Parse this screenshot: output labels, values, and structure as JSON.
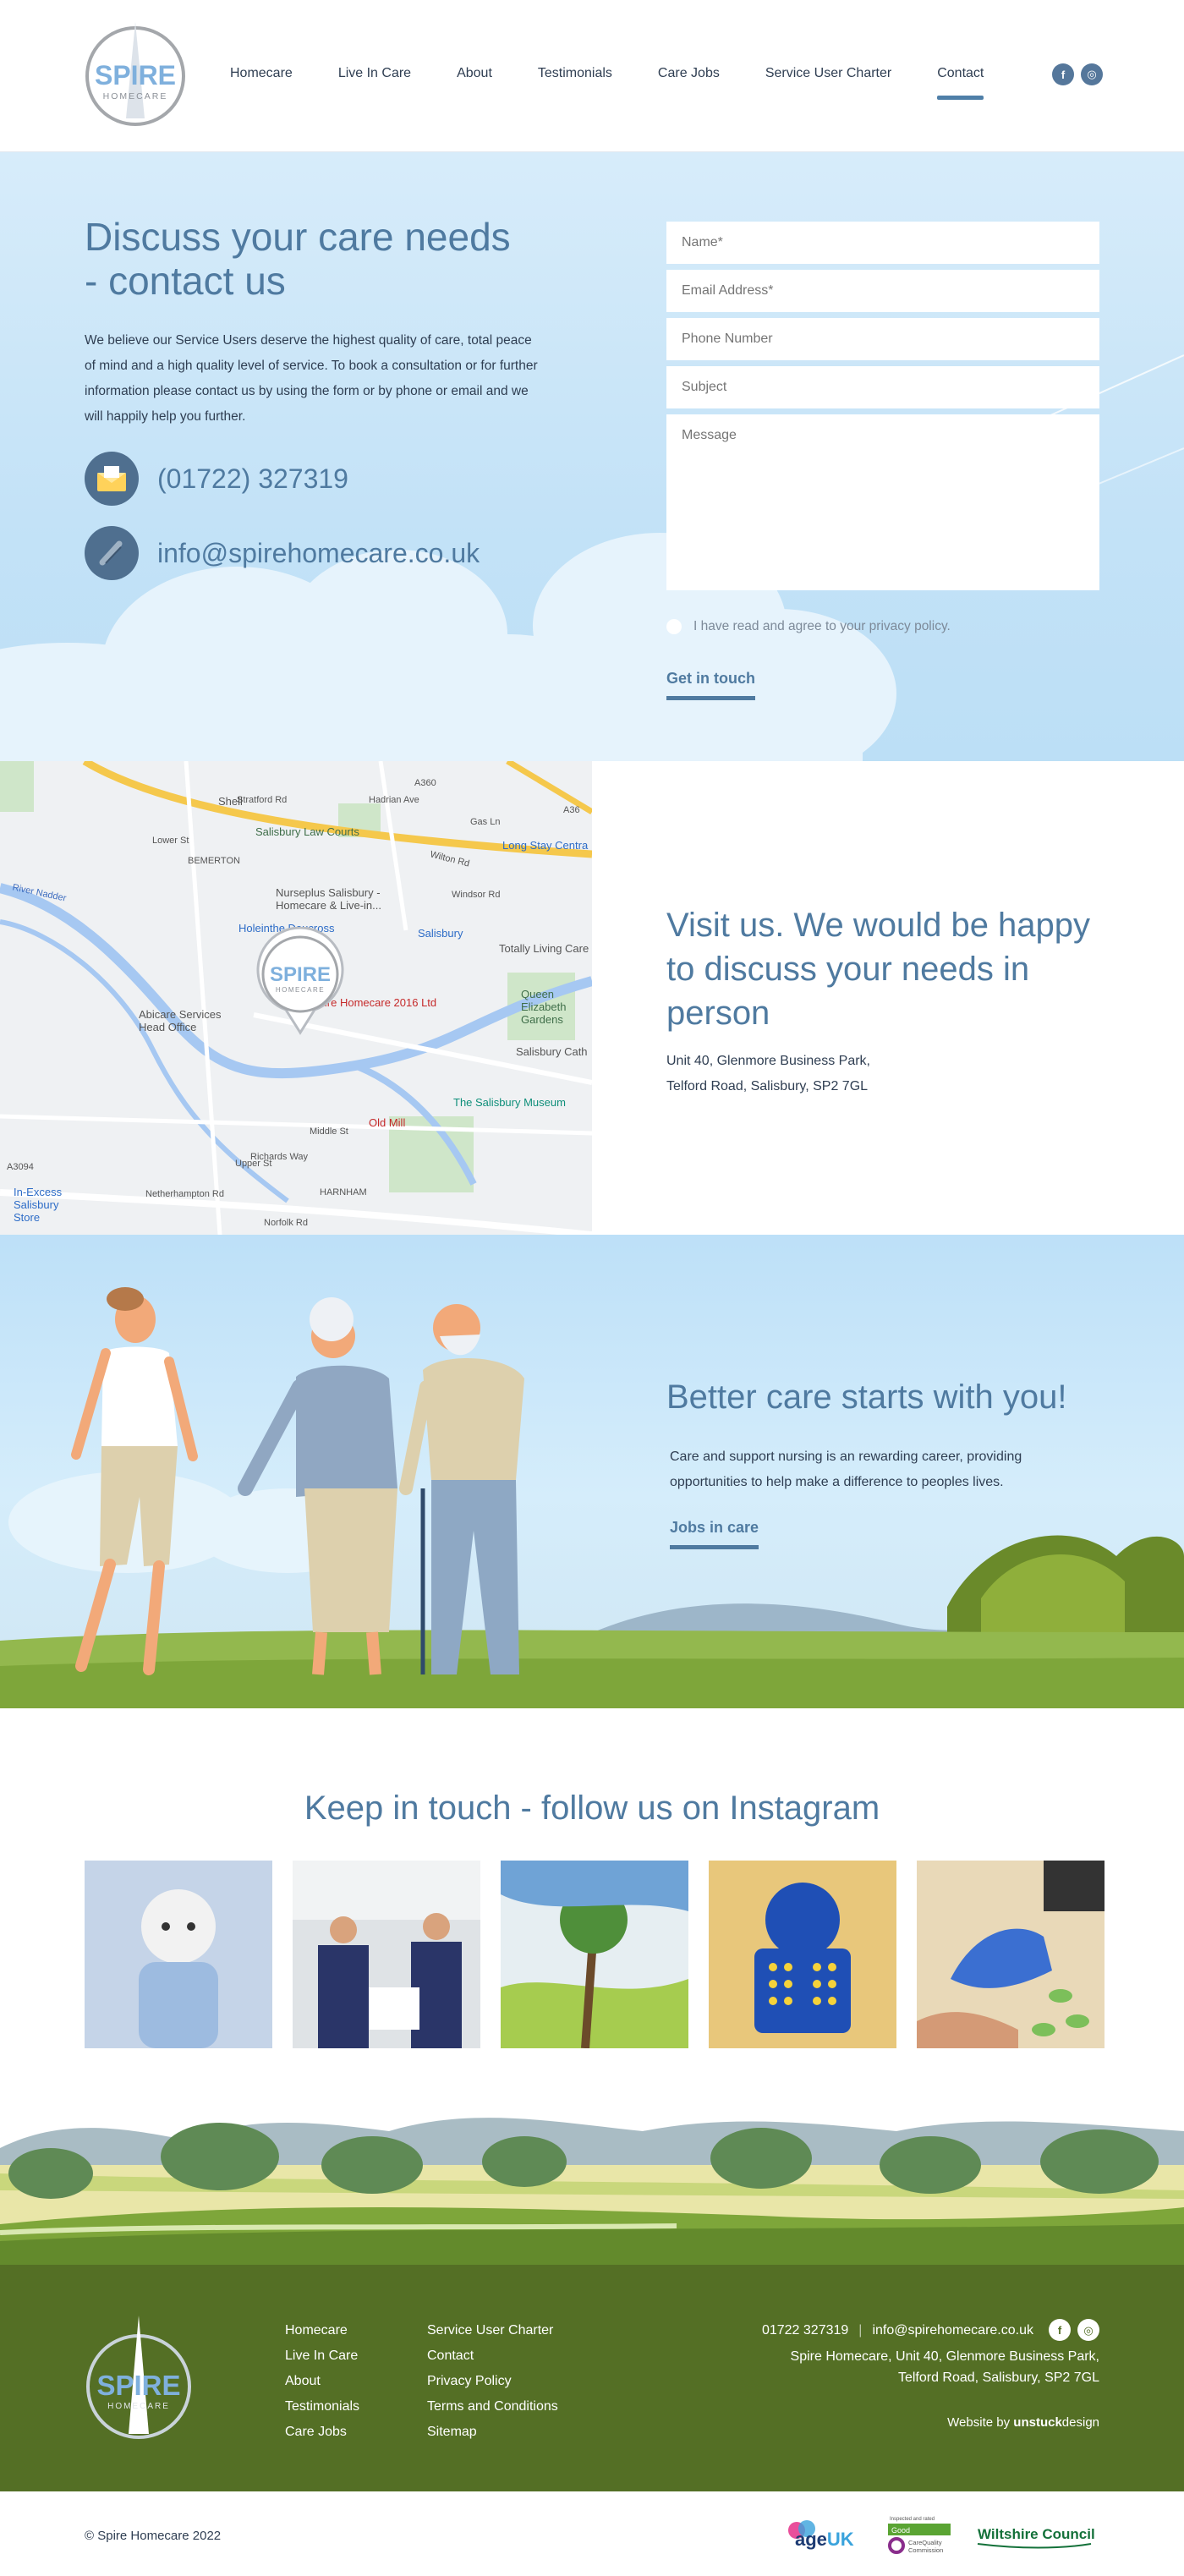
{
  "brand": {
    "name": "SPIRE",
    "sub": "HOMECARE"
  },
  "nav": [
    "Homecare",
    "Live In Care",
    "About",
    "Testimonials",
    "Care Jobs",
    "Service User Charter",
    "Contact"
  ],
  "social": {
    "facebook": "f",
    "instagram": "◎"
  },
  "contact": {
    "title": "Discuss your care needs - contact us",
    "intro": "We believe our Service Users deserve the highest quality of care, total peace of mind and a high quality level of service. To book a consultation or for further information please contact us by using the form or by phone or email and we will happily help you further.",
    "phone": "(01722) 327319",
    "email": "info@spirehomecare.co.uk",
    "form": {
      "name": "Name*",
      "email": "Email Address*",
      "phone": "Phone Number",
      "subject": "Subject",
      "message": "Message"
    },
    "privacy": "I have read and agree to your privacy policy.",
    "submit": "Get in touch"
  },
  "map": {
    "labels": [
      "Salisbury Law Courts",
      "Nurseplus Salisbury - Homecare & Live-in...",
      "Holeinthe Doucross",
      "Spire Homecare 2016 Ltd",
      "Abicare Services Head Office",
      "Salisbury",
      "Totally Living Care",
      "Queen Elizabeth Gardens",
      "Salisbury Cath",
      "The Salisbury Museum",
      "Old Mill",
      "In-Excess Salisbury Store",
      "Long Stay Centra",
      "Shell",
      "River Nadder",
      "BEMERTON",
      "Wilton Rd",
      "Netherhampton Rd",
      "HARNHAM",
      "A3094",
      "A360",
      "A36",
      "Middle St",
      "Richards Way",
      "Norfolk Rd",
      "Windsor Rd",
      "Lower St",
      "Upper St",
      "Gas Ln",
      "Hadrian Ave",
      "Stratford Rd"
    ]
  },
  "visit": {
    "title": "Visit us. We would be happy to discuss your needs in person",
    "address": [
      "Unit 40, Glenmore Business Park,",
      "Telford Road, Salisbury, SP2 7GL"
    ]
  },
  "better": {
    "title": "Better care starts with you!",
    "text": "Care and support nursing is an rewarding career, providing opportunities to help make a difference to peoples lives.",
    "cta": "Jobs in care"
  },
  "instagram": {
    "title": "Keep in touch - follow us on Instagram"
  },
  "footer": {
    "col1": [
      "Homecare",
      "Live In Care",
      "About",
      "Testimonials",
      "Care Jobs"
    ],
    "col2": [
      "Service User Charter",
      "Contact",
      "Privacy Policy",
      "Terms and Conditions",
      "Sitemap"
    ],
    "phone": "01722 327319",
    "email": "info@spirehomecare.co.uk",
    "address": [
      "Spire Homecare, Unit 40, Glenmore Business Park,",
      "Telford Road, Salisbury, SP2 7GL"
    ],
    "credit_prefix": "Website by",
    "credit_a": "unstuck",
    "credit_b": "design",
    "copyright": "© Spire Homecare 2022",
    "badges": {
      "ageuk_a": "age",
      "ageuk_b": "UK",
      "cqc_top": "Inspected and rated",
      "cqc_good": "Good",
      "cqc_a": "CareQuality",
      "cqc_b": "Commission",
      "wiltshire": "Wiltshire Council"
    }
  },
  "colors": {
    "accent": "#4f7aa0",
    "footer": "#546f25",
    "sky": "#c3e2f7"
  }
}
